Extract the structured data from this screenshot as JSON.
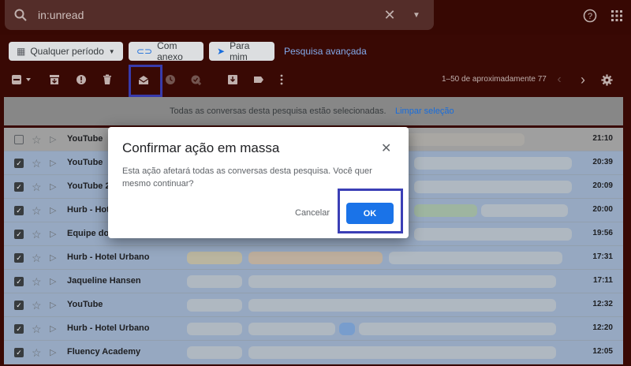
{
  "search": {
    "query": "in:unread"
  },
  "chips": [
    {
      "label": "Qualquer período",
      "icon": "calendar-icon"
    },
    {
      "label": "Com anexo",
      "icon": "attachment-icon"
    },
    {
      "label": "Para mim",
      "icon": "send-icon"
    }
  ],
  "advanced_search": "Pesquisa avançada",
  "toolbar": {
    "range": "1–50 de aproximadamente 77"
  },
  "banner": {
    "message": "Todas as conversas desta pesquisa estão selecionadas.",
    "clear": "Limpar seleção"
  },
  "rows": [
    {
      "sender": "YouTube",
      "time": "21:10",
      "checked": false
    },
    {
      "sender": "YouTube",
      "time": "20:39",
      "checked": true
    },
    {
      "sender": "YouTube 2",
      "time": "20:09",
      "checked": true
    },
    {
      "sender": "Hurb - Hotel",
      "time": "20:00",
      "checked": true
    },
    {
      "sender": "Equipe do",
      "time": "19:56",
      "checked": true
    },
    {
      "sender": "Hurb - Hotel Urbano",
      "time": "17:31",
      "checked": true
    },
    {
      "sender": "Jaqueline Hansen",
      "time": "17:11",
      "checked": true
    },
    {
      "sender": "YouTube",
      "time": "12:32",
      "checked": true
    },
    {
      "sender": "Hurb - Hotel Urbano",
      "time": "12:20",
      "checked": true
    },
    {
      "sender": "Fluency Academy",
      "time": "12:05",
      "checked": true
    }
  ],
  "dialog": {
    "title": "Confirmar ação em massa",
    "body": "Esta ação afetará todas as conversas desta pesquisa. Você quer mesmo continuar?",
    "cancel": "Cancelar",
    "ok": "OK"
  },
  "colors": {
    "accent": "#1a73e8",
    "highlight": "#3b3fb6"
  }
}
